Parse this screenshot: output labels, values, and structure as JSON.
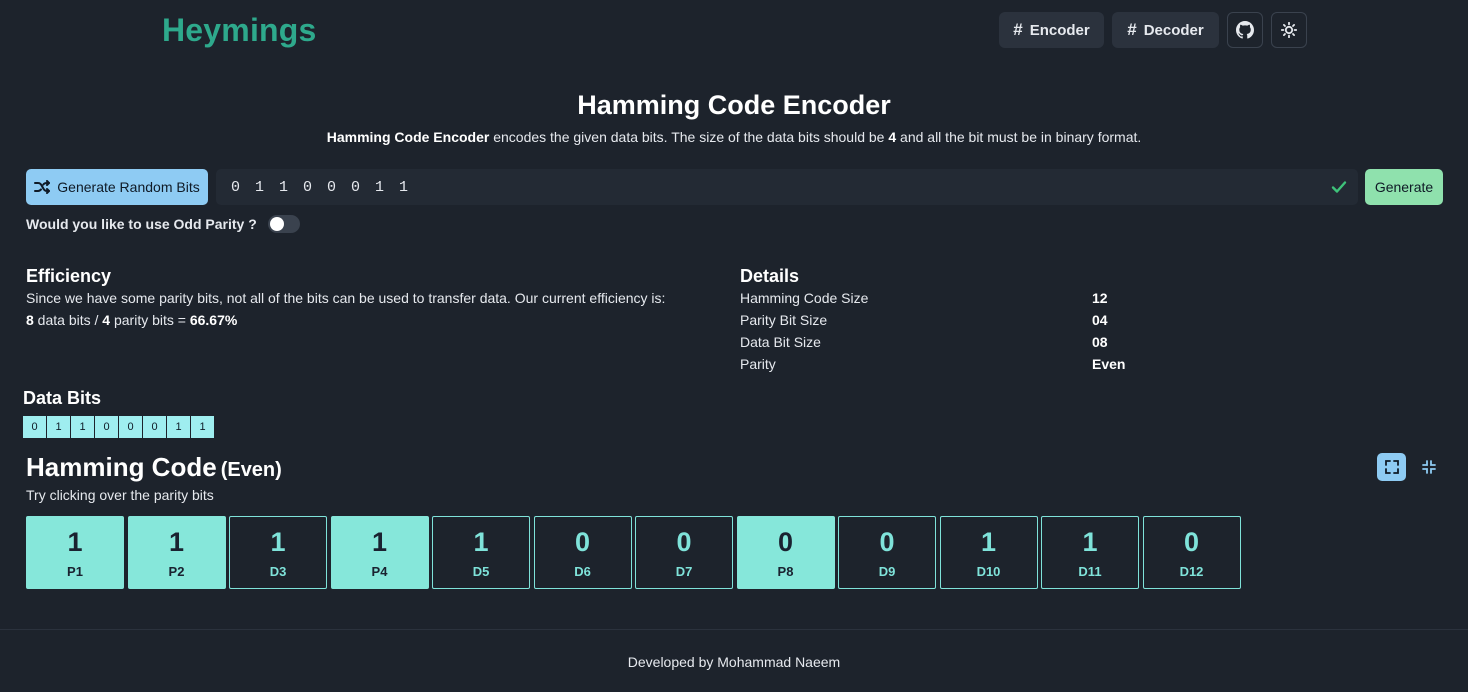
{
  "header": {
    "brand": "Heymings",
    "nav": [
      {
        "label": "Encoder"
      },
      {
        "label": "Decoder"
      }
    ],
    "hash_symbol": "#"
  },
  "intro": {
    "title": "Hamming Code Encoder",
    "subtitle_bold": "Hamming Code Encoder",
    "subtitle_mid": " encodes the given data bits. The size of the data bits should be ",
    "subtitle_num": "4",
    "subtitle_end": " and all the bit must be in binary format."
  },
  "controls": {
    "random_label": "Generate Random Bits",
    "input_value": "01100011",
    "generate_label": "Generate",
    "odd_prefix": "Would you like to use ",
    "odd_bold": "Odd Parity",
    "odd_suffix": " ?",
    "odd_parity_enabled": false
  },
  "efficiency": {
    "heading": "Efficiency",
    "text": "Since we have some parity bits, not all of the bits can be used to transfer data. Our current efficiency is:",
    "data_bits": "8",
    "data_label": " data bits / ",
    "parity_bits": "4",
    "parity_label": " parity bits = ",
    "percent": "66.67%"
  },
  "details": {
    "heading": "Details",
    "rows": [
      {
        "label": "Hamming Code Size",
        "value": "12"
      },
      {
        "label": "Parity Bit Size",
        "value": "04"
      },
      {
        "label": "Data Bit Size",
        "value": "08"
      },
      {
        "label": "Parity",
        "value": "Even"
      }
    ]
  },
  "data_bits": {
    "heading": "Data Bits",
    "bits": [
      "0",
      "1",
      "1",
      "0",
      "0",
      "0",
      "1",
      "1"
    ]
  },
  "hamming": {
    "heading": "Hamming Code",
    "parity_tag": "(Even)",
    "hint": "Try clicking over the parity bits",
    "cells": [
      {
        "bit": "1",
        "label": "P1",
        "parity": true
      },
      {
        "bit": "1",
        "label": "P2",
        "parity": true
      },
      {
        "bit": "1",
        "label": "D3",
        "parity": false
      },
      {
        "bit": "1",
        "label": "P4",
        "parity": true
      },
      {
        "bit": "1",
        "label": "D5",
        "parity": false
      },
      {
        "bit": "0",
        "label": "D6",
        "parity": false
      },
      {
        "bit": "0",
        "label": "D7",
        "parity": false
      },
      {
        "bit": "0",
        "label": "P8",
        "parity": true
      },
      {
        "bit": "0",
        "label": "D9",
        "parity": false
      },
      {
        "bit": "1",
        "label": "D10",
        "parity": false
      },
      {
        "bit": "1",
        "label": "D11",
        "parity": false
      },
      {
        "bit": "0",
        "label": "D12",
        "parity": false
      }
    ]
  },
  "footer": {
    "text": "Developed by Mohammad Naeem"
  },
  "colors": {
    "brand": "#2ea98c",
    "accent_blue": "#8ecbf3",
    "accent_green": "#8fe1ad",
    "cell_teal": "#86e7da",
    "bit_cyan": "#9feef0",
    "background": "#1d232c"
  },
  "icons": {
    "random": "shuffle-icon",
    "valid": "check-icon",
    "github": "github-icon",
    "theme": "sun-icon",
    "expand": "expand-icon",
    "shrink": "shrink-icon"
  }
}
